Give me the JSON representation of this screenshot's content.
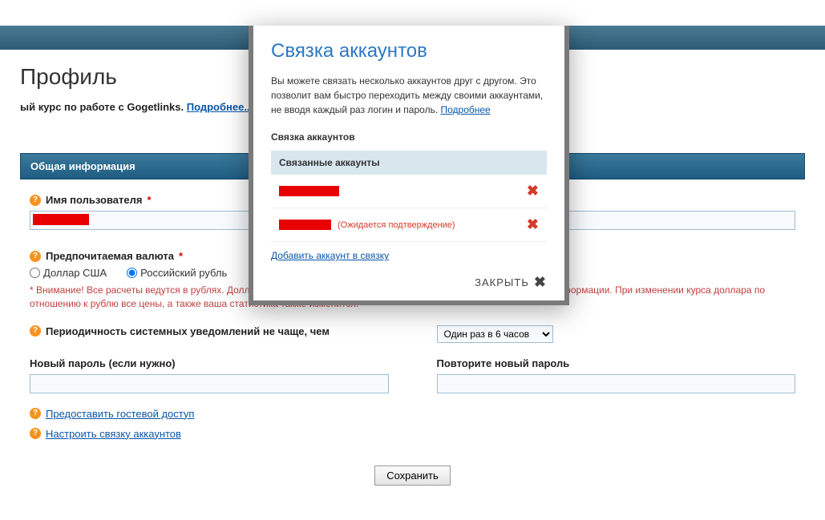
{
  "page": {
    "title": "Профиль",
    "course_prefix": "ый курс по работе с Gogetlinks. ",
    "course_link": "Подробнее..."
  },
  "section": {
    "general_info": "Общая информация",
    "username_label": "Имя пользователя",
    "currency_label": "Предпочитаемая валюта",
    "currency_usd": "Доллар США",
    "currency_rub": "Российский рубль",
    "currency_warning_prefix": "* ",
    "currency_warning": "Внимание! Все расчеты ведутся в рублях. Доллары США могут использоваться лишь для удобства отображаемой информации. При изменении курса доллара по отношению к рублю все цены, а также ваша статистика также изменится.",
    "notify_label": "Периодичность системных уведомлений не чаще, чем",
    "notify_option": "Один раз в 6 часов",
    "password_new": "Новый пароль (если нужно)",
    "password_repeat": "Повторите новый пароль",
    "guest_link": "Предоставить гостевой доступ",
    "link_accounts": "Настроить связку аккаунтов",
    "save_btn": "Сохранить"
  },
  "modal": {
    "title": "Связка аккаунтов",
    "desc": "Вы можете связать несколько аккаунтов друг с другом. Это позволит вам быстро переходить между своими аккаунтами, не вводя каждый раз логин и пароль. ",
    "more": "Подробнее",
    "subtitle": "Связка аккаунтов",
    "table_header": "Связанные аккаунты",
    "pending": "(Ожидается подтверждение)",
    "add_link": "Добавить аккаунт в связку",
    "close": "ЗАКРЫТЬ"
  }
}
